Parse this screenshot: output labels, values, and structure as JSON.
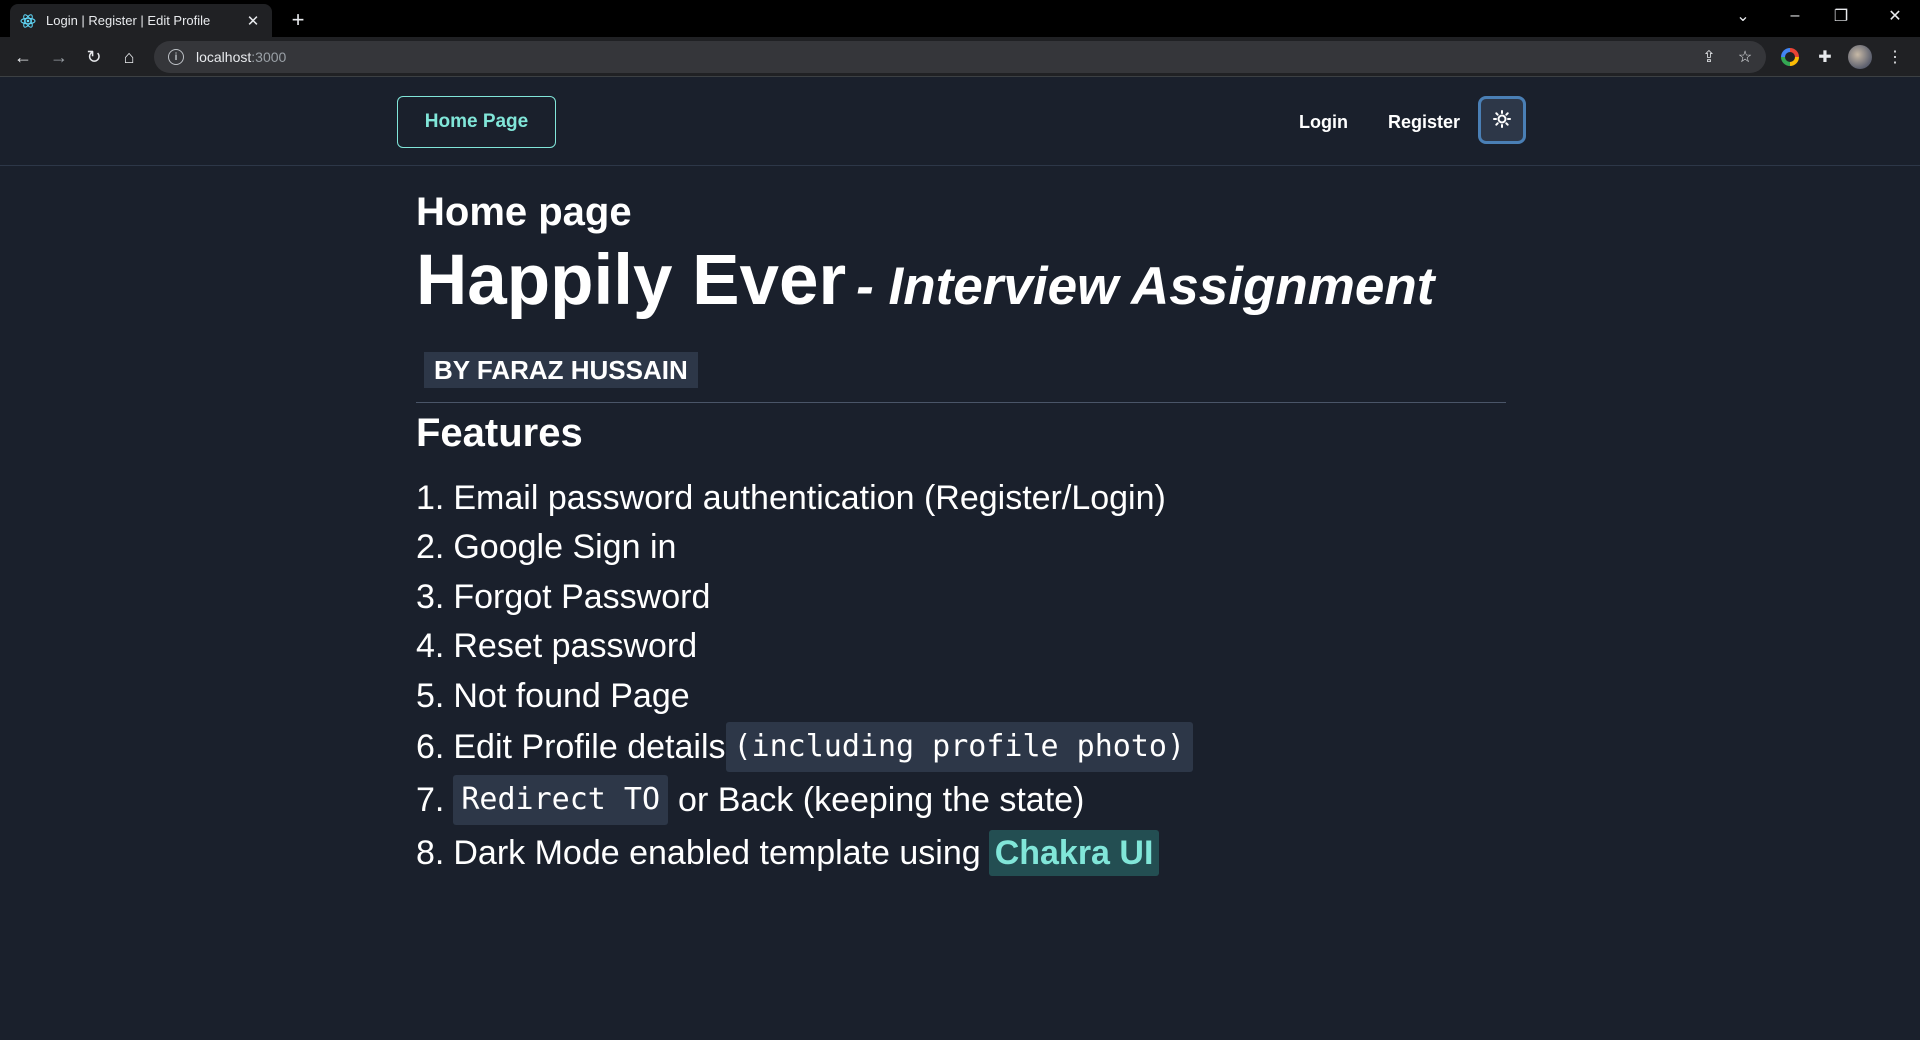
{
  "browser": {
    "tab_title": "Login | Register | Edit Profile",
    "url_host": "localhost",
    "url_port": ":3000"
  },
  "navbar": {
    "home_label": "Home Page",
    "login_label": "Login",
    "register_label": "Register"
  },
  "main": {
    "page_title": "Home page",
    "headline": "Happily Ever",
    "subheadline": "- Interview Assignment",
    "byline": "BY FARAZ HUSSAIN",
    "features_title": "Features",
    "features": [
      {
        "num": "1.",
        "text": "Email password authentication (Register/Login)"
      },
      {
        "num": "2.",
        "text": "Google Sign in"
      },
      {
        "num": "3.",
        "text": "Forgot Password"
      },
      {
        "num": "4.",
        "text": "Reset password"
      },
      {
        "num": "5.",
        "text": "Not found Page"
      },
      {
        "num": "6.",
        "text": "Edit Profile details",
        "code": "(including profile photo)"
      },
      {
        "num": "7.",
        "code": "Redirect TO",
        "text": "or Back (keeping the state)"
      },
      {
        "num": "8.",
        "text": "Dark Mode enabled template using",
        "highlight": "Chakra UI"
      }
    ]
  },
  "colors": {
    "background": "#1a202c",
    "accent": "#81e6d9",
    "code_bg": "#2d3748"
  }
}
